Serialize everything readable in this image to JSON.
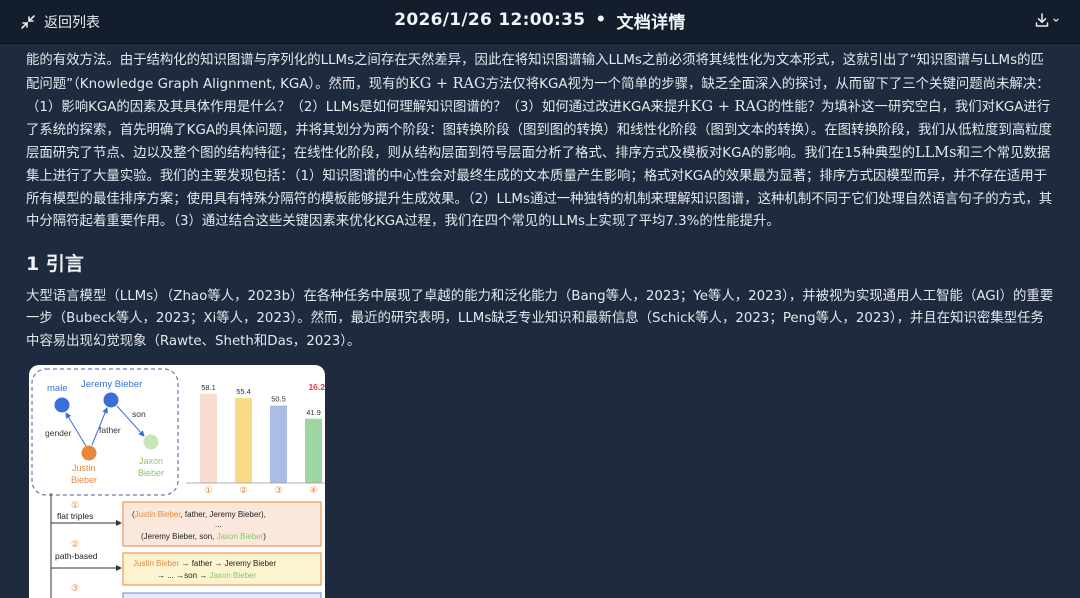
{
  "topbar": {
    "back_label": "返回列表",
    "datetime": "2026/1/26 12:00:35",
    "separator": "•",
    "page_title": "文档详情"
  },
  "document": {
    "para1": [
      {
        "t": "能的有效方法。由于结构化的知识图谱与序列化的LLMs之间存在天然差异，因此在将知识图谱输入LLMs之前必须将其线性化为文本形式，这就引出了“知识图谱与LLMs的匹配问题”（Knowledge Graph Alignment, KGA）。然而，现有的"
      },
      {
        "t": "KG + RAG",
        "math": true
      },
      {
        "t": "方法仅将KGA视为一个简单的步骤，缺乏全面深入的探讨，从而留下了三个关键问题尚未解决：（1）影响KGA的因素及其具体作用是什么？（2）LLMs是如何理解知识图谱的？（3）如何通过改进KGA来提升"
      },
      {
        "t": "KG + RAG",
        "math": true
      },
      {
        "t": "的性能？为填补这一研究空白，我们对KGA进行了系统的探索，首先明确了KGA的具体问题，并将其划分为两个阶段：图转换阶段（图到图的转换）和线性化阶段（图到文本的转换）。在图转换阶段，我们从低粒度到高粒度层面研究了节点、边以及整个图的结构特征；在线性化阶段，则从结构层面到符号层面分析了格式、排序方式及模板对KGA的影响。我们在15种典型的"
      },
      {
        "t": "LLMs",
        "math": true
      },
      {
        "t": "和三个常见数据集上进行了大量实验。我们的主要发现包括：（1）知识图谱的中心性会对最终生成的文本质量产生影响；格式对KGA的效果最为显著；排序方式因模型而异，并不存在适用于所有模型的最佳排序方案；使用具有特殊分隔符的模板能够提升生成效果。（2）LLMs通过一种独特的机制来理解知识图谱，这种机制不同于它们处理自然语言句子的方式，其中分隔符起着重要作用。（3）通过结合这些关键因素来优化KGA过程，我们在四个常见的LLMs上实现了平均7.3%的性能提升。"
      }
    ],
    "section_title": "1 引言",
    "para2": "大型语言模型（LLMs）（Zhao等人，2023b）在各种任务中展现了卓越的能力和泛化能力（Bang等人，2023；Ye等人，2023），并被视为实现通用人工智能（AGI）的重要一步（Bubeck等人，2023；Xi等人，2023）。然而，最近的研究表明，LLMs缺乏专业知识和最新信息（Schick等人，2023；Peng等人，2023），并且在知识密集型任务中容易出现幻觉现象（Rawte、Sheth和Das，2023）。"
  },
  "figure": {
    "graph": {
      "nodes": [
        "male",
        "Jeremy Bieber",
        "Justin Bieber",
        "Jaxon Bieber"
      ],
      "edges": [
        "gender",
        "father",
        "son"
      ]
    },
    "chart_data": {
      "type": "bar",
      "categories": [
        "①",
        "②",
        "③",
        "④"
      ],
      "values": [
        58.1,
        55.4,
        50.5,
        41.9
      ],
      "value_labels": [
        "58.1",
        "55.4",
        "50.5",
        "41.9"
      ],
      "annotation": "16.2",
      "colors": [
        "#f8dcd0",
        "#f7dc85",
        "#a9bde6",
        "#9ed6a2"
      ]
    },
    "formats": [
      {
        "num": "①",
        "name": "flat triples",
        "line1a": "(",
        "line1b": "Justin Bieber",
        "line1c": ", father, Jeremy Bieber),",
        "line2": "...",
        "line3a": "(Jeremy Bieber, son, ",
        "line3b": "Jaxon Bieber",
        "line3c": ")"
      },
      {
        "num": "②",
        "name": "path-based",
        "line1a": "Justin Bieber",
        "line1b": " → father → Jeremy Bieber",
        "line2a": "→ ... →son → ",
        "line2b": "Jaxon Bieber"
      },
      {
        "num": "③"
      }
    ]
  },
  "colors": {
    "background": "#1e2a3d",
    "topbar": "#141d2b",
    "accent_red": "#e03a3a",
    "justin": "#e8873d",
    "jaxon": "#a6d48a",
    "male_node": "#3a6fd8"
  },
  "icons": {
    "back": "collapse-arrows-icon",
    "download": "download-icon",
    "dropdown": "chevron-down-icon"
  }
}
